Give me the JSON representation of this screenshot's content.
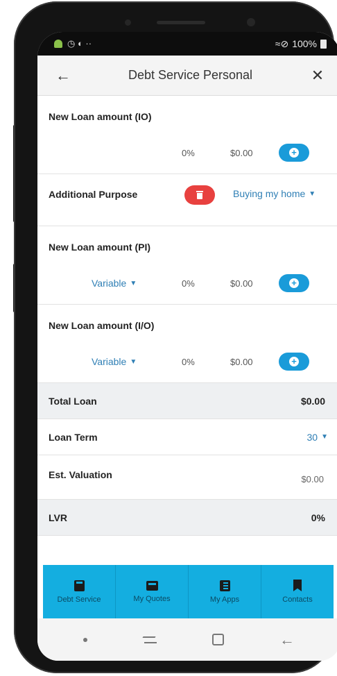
{
  "status_bar": {
    "left_glyphs": "◷ ◐ ··",
    "signal": "≈⊘",
    "battery": "100%"
  },
  "header": {
    "title": "Debt Service Personal",
    "back_icon": "←",
    "close_icon": "✕"
  },
  "loans": [
    {
      "label": "New Loan amount (IO)",
      "rate_type": "",
      "percent": "0%",
      "amount": "$0.00"
    },
    {
      "label": "New Loan amount (PI)",
      "rate_type": "Variable",
      "percent": "0%",
      "amount": "$0.00"
    },
    {
      "label": "New Loan amount (I/O)",
      "rate_type": "Variable",
      "percent": "0%",
      "amount": "$0.00"
    }
  ],
  "purpose": {
    "label": "Additional Purpose",
    "selected": "Buying my home"
  },
  "summary": {
    "total_loan_label": "Total Loan",
    "total_loan_value": "$0.00",
    "loan_term_label": "Loan Term",
    "loan_term_value": "30",
    "valuation_label": "Est. Valuation",
    "valuation_value": "$0.00",
    "lvr_label": "LVR",
    "lvr_value": "0%"
  },
  "bottom_nav": {
    "items": [
      {
        "label": "Debt Service",
        "icon": "calculator-icon"
      },
      {
        "label": "My Quotes",
        "icon": "quotes-icon"
      },
      {
        "label": "My Apps",
        "icon": "apps-icon"
      },
      {
        "label": "Contacts",
        "icon": "bookmark-icon"
      }
    ]
  },
  "system_nav": {
    "back_icon": "←"
  },
  "colors": {
    "accent": "#1a9bd9",
    "link": "#2f7fb5",
    "danger": "#e8413f",
    "nav_background": "#14aee0"
  }
}
